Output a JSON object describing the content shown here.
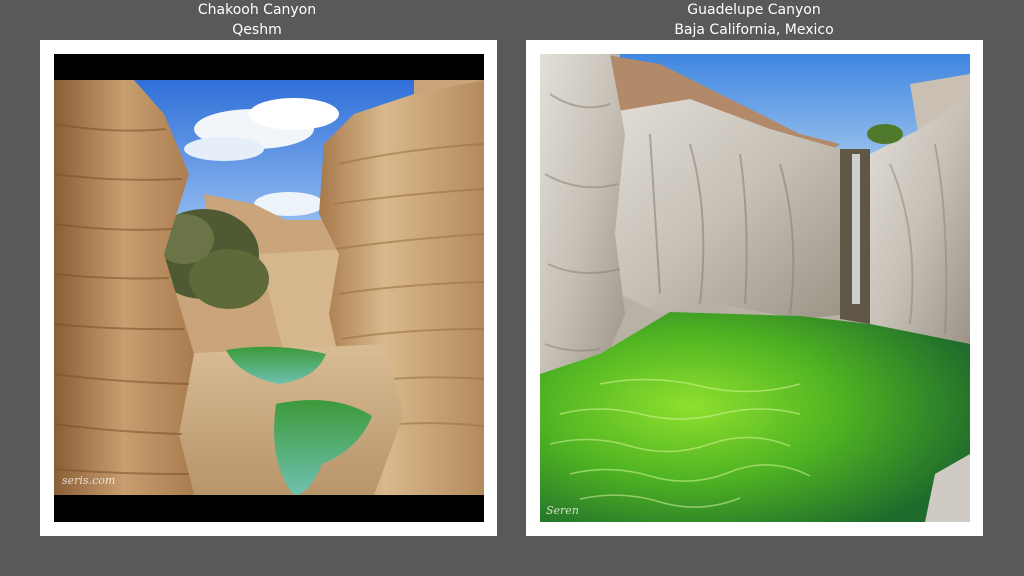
{
  "slide": {
    "left": {
      "title": "Chakooh Canyon",
      "subtitle": "Qeshm",
      "watermark": "seris.com"
    },
    "right": {
      "title": "Guadelupe Canyon",
      "subtitle": "Baja California, Mexico",
      "watermark": "Seren"
    }
  },
  "colors": {
    "background": "#595959",
    "frame": "#ffffff",
    "sky": "#4a8ee6",
    "sandstone": "#c9a47a",
    "granite": "#cfcac3",
    "pool_green": "#5fc229"
  }
}
